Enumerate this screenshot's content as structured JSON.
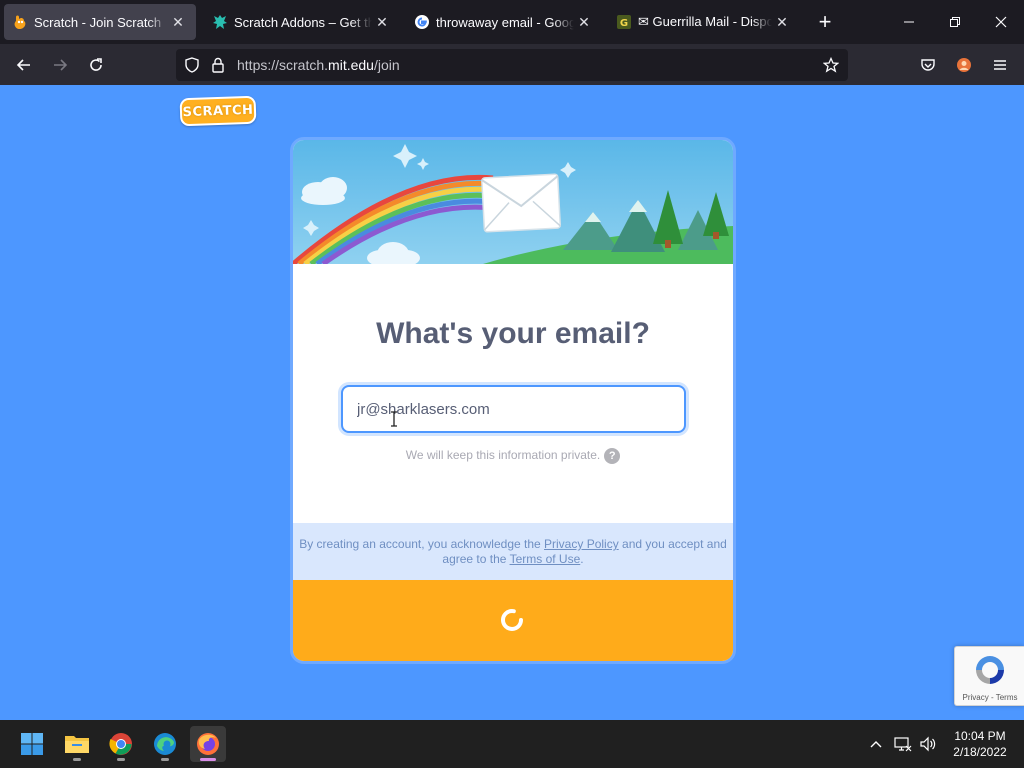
{
  "browser": {
    "tabs": [
      {
        "title": "Scratch - Join Scratch",
        "icon": "scratch-cat-favicon",
        "active": true
      },
      {
        "title": "Scratch Addons – Get this E",
        "icon": "scratch-addons-favicon",
        "active": false
      },
      {
        "title": "throwaway email - Google S",
        "icon": "google-favicon",
        "active": false
      },
      {
        "title": "✉ Guerrilla Mail - Disposab",
        "icon": "guerrilla-mail-favicon",
        "active": false
      }
    ],
    "url_prefix": "https://scratch.",
    "url_host": "mit.edu",
    "url_path": "/join"
  },
  "page": {
    "logo_text": "SCRATCH",
    "heading": "What's your email?",
    "email_value": "jr@sharklasers.com",
    "privacy_note": "We will keep this information private.",
    "help_glyph": "?",
    "terms_prefix": "By creating an account, you acknowledge the ",
    "privacy_link": "Privacy Policy",
    "terms_middle": " and you accept and agree to the ",
    "terms_link": "Terms of Use",
    "terms_suffix": ".",
    "submit_state": "loading-spinner"
  },
  "recaptcha": {
    "links": "Privacy - Terms"
  },
  "taskbar": {
    "apps": [
      "windows-start",
      "file-explorer",
      "chrome",
      "edge",
      "firefox"
    ],
    "time": "10:04 PM",
    "date": "2/18/2022"
  },
  "colors": {
    "page_bg": "#4d97ff",
    "heading": "#575e75",
    "submit_bar": "#ffab1a",
    "terms_bg": "#d9e7fd",
    "input_border": "#4d97ff"
  }
}
